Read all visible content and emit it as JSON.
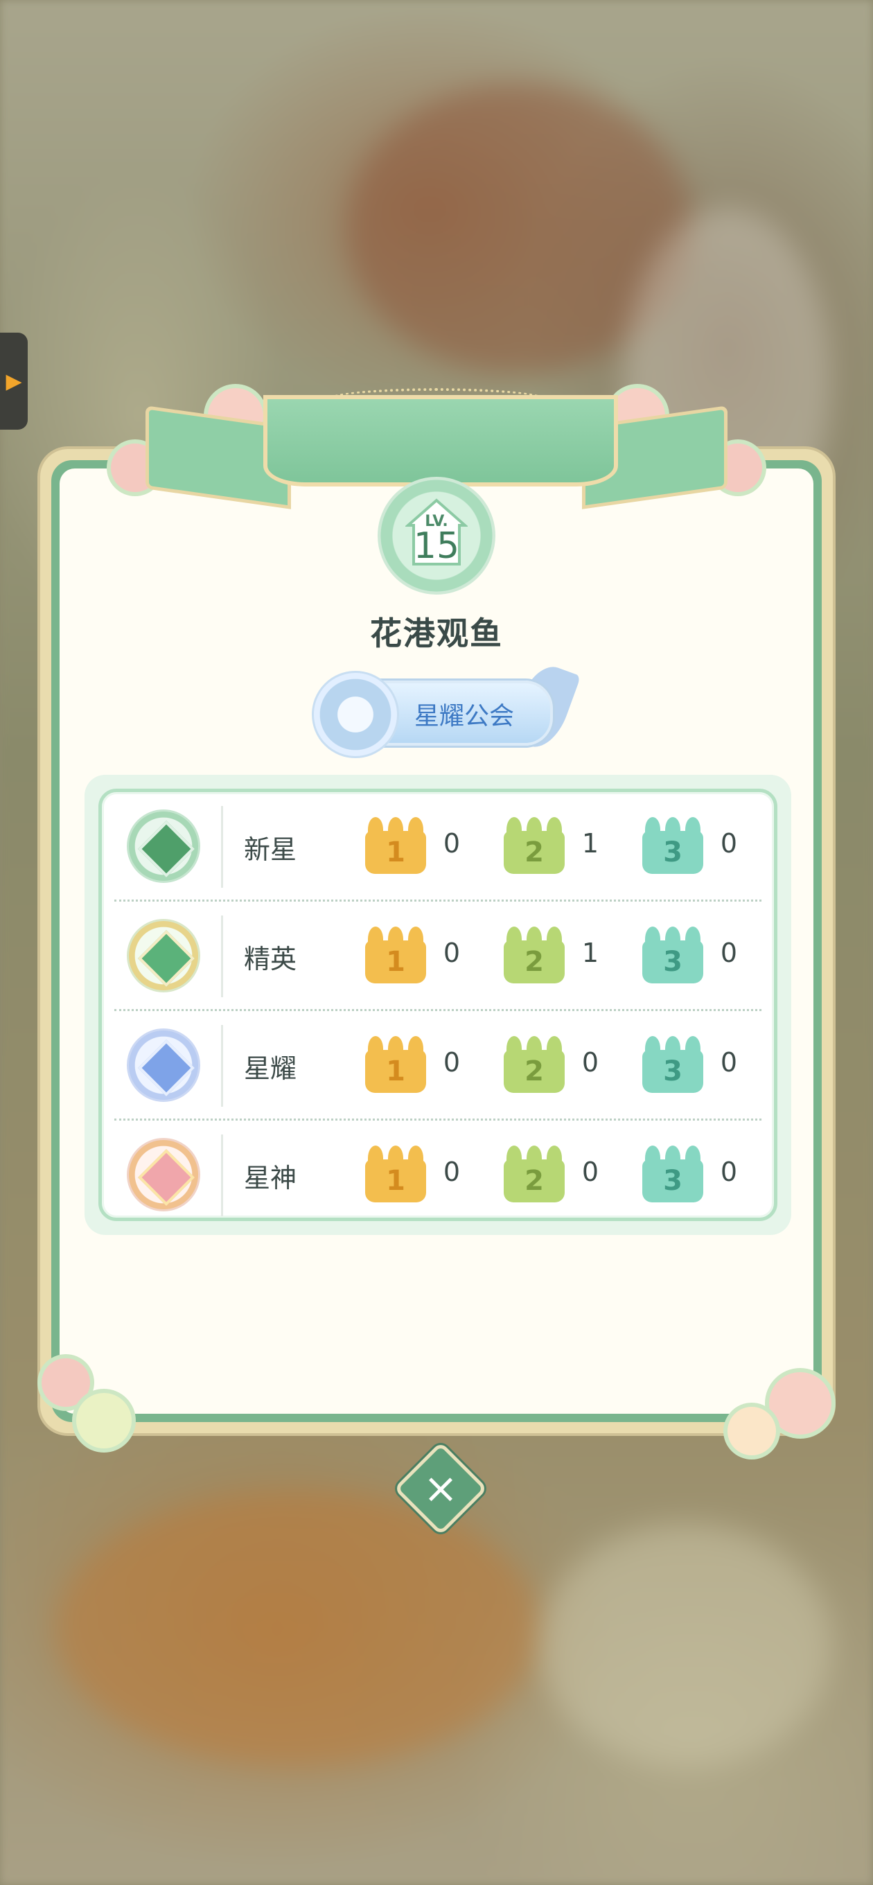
{
  "header": {
    "level_label": "LV.",
    "level_value": "15",
    "title": "花港观鱼",
    "guild_name": "星耀公会"
  },
  "ranks": [
    {
      "name": "新星",
      "icon": "green-star-gem-icon",
      "counts": [
        "0",
        "1",
        "0"
      ]
    },
    {
      "name": "精英",
      "icon": "gold-green-star-gem-icon",
      "counts": [
        "0",
        "1",
        "0"
      ]
    },
    {
      "name": "星耀",
      "icon": "blue-star-gem-icon",
      "counts": [
        "0",
        "0",
        "0"
      ]
    },
    {
      "name": "星神",
      "icon": "pink-gold-star-gem-icon",
      "counts": [
        "0",
        "0",
        "0"
      ]
    }
  ],
  "crowns": [
    {
      "label": "1",
      "color": "#f3be4e",
      "icon": "gold-crown-icon"
    },
    {
      "label": "2",
      "color": "#b7d774",
      "icon": "green-crown-icon"
    },
    {
      "label": "3",
      "color": "#86d7c2",
      "icon": "teal-crown-icon"
    }
  ],
  "colors": {
    "panel_green": "#79b58d",
    "panel_cream": "#fffdf4",
    "text_dark": "#3a4a48",
    "guild_blue": "#3d79c4"
  },
  "controls": {
    "close_icon": "close-icon",
    "side_handle_icon": "chevron-right-icon"
  }
}
